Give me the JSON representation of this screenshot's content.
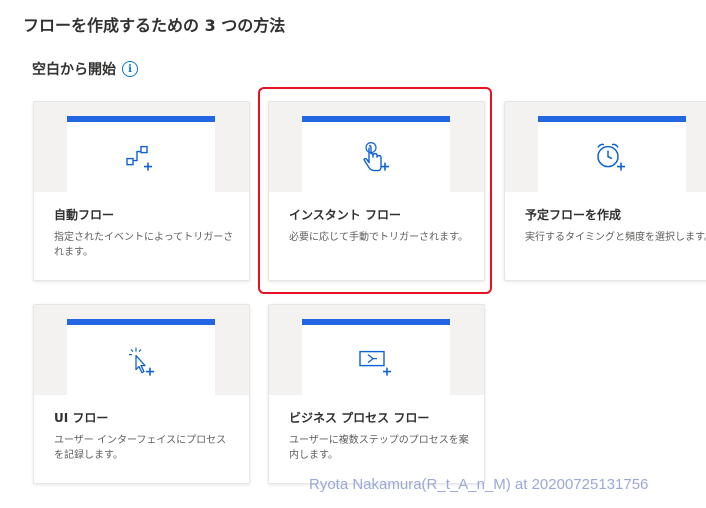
{
  "header": {
    "title": "フローを作成するための 3 つの方法"
  },
  "section": {
    "title": "空白から開始",
    "info_glyph": "i"
  },
  "cards": [
    {
      "id": "automated",
      "title": "自動フロー",
      "description": "指定されたイベントによってトリガーされます。",
      "icon": "connector-plus-icon"
    },
    {
      "id": "instant",
      "title": "インスタント フロー",
      "description": "必要に応じて手動でトリガーされます。",
      "icon": "touch-hand-plus-icon",
      "selected": true
    },
    {
      "id": "scheduled",
      "title": "予定フローを作成",
      "description": "実行するタイミングと頻度を選択します。",
      "icon": "alarm-clock-plus-icon"
    },
    {
      "id": "ui",
      "title": "UI フロー",
      "description": "ユーザー インターフェイスにプロセスを記録します。",
      "icon": "cursor-click-plus-icon"
    },
    {
      "id": "business-process",
      "title": "ビジネス プロセス フロー",
      "description": "ユーザーに複数ステップのプロセスを案内します。",
      "icon": "process-step-plus-icon"
    }
  ],
  "colors": {
    "accent_blue": "#2266e3",
    "icon_blue": "#0f62d6",
    "selection_red": "#e81123",
    "watermark": "#9aa9d8"
  },
  "watermark": "Ryota Nakamura(R_t_A_n_M) at 20200725131756"
}
